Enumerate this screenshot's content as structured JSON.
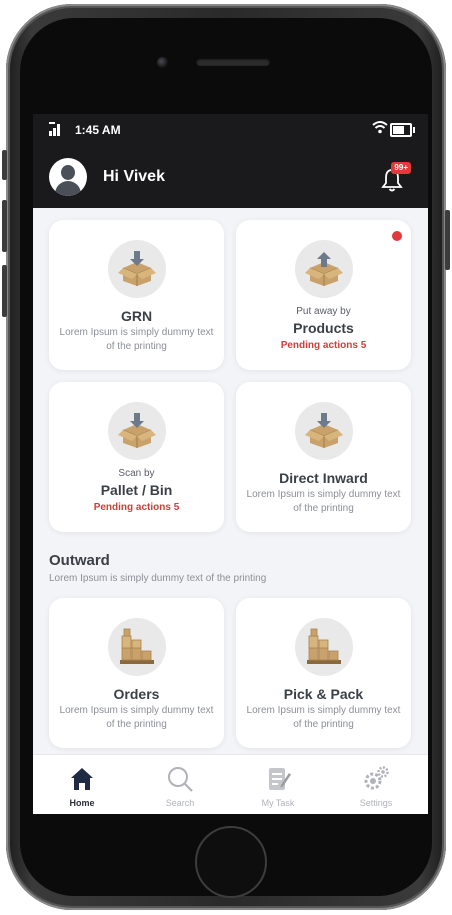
{
  "status_bar": {
    "time": "1:45 AM"
  },
  "header": {
    "greeting": "Hi Vivek",
    "notification_badge": "99+"
  },
  "inward_cards": [
    {
      "title": "GRN",
      "description": "Lorem Ipsum is simply dummy text of the printing"
    },
    {
      "prefix": "Put away by",
      "title": "Products",
      "pending": "Pending actions 5"
    },
    {
      "prefix": "Scan by",
      "title": "Pallet / Bin",
      "pending": "Pending actions 5"
    },
    {
      "title": "Direct Inward",
      "description": "Lorem Ipsum is simply dummy text of the printing"
    }
  ],
  "outward": {
    "title": "Outward",
    "subtitle": "Lorem Ipsum is simply dummy text of the printing",
    "cards": [
      {
        "title": "Orders",
        "description": "Lorem Ipsum is simply dummy text of the printing"
      },
      {
        "title": "Pick & Pack",
        "description": "Lorem Ipsum is simply dummy text of the printing"
      }
    ]
  },
  "tabs": [
    {
      "label": "Home",
      "icon": "home-icon",
      "active": true
    },
    {
      "label": "Search",
      "icon": "search-icon",
      "active": false
    },
    {
      "label": "My Task",
      "icon": "task-icon",
      "active": false
    },
    {
      "label": "Settings",
      "icon": "settings-icon",
      "active": false
    }
  ],
  "colors": {
    "header_bg": "#1a1a1d",
    "pending_red": "#d33c3c",
    "fab_blue": "#2f72d6",
    "screen_bg": "#f3f4f7"
  }
}
